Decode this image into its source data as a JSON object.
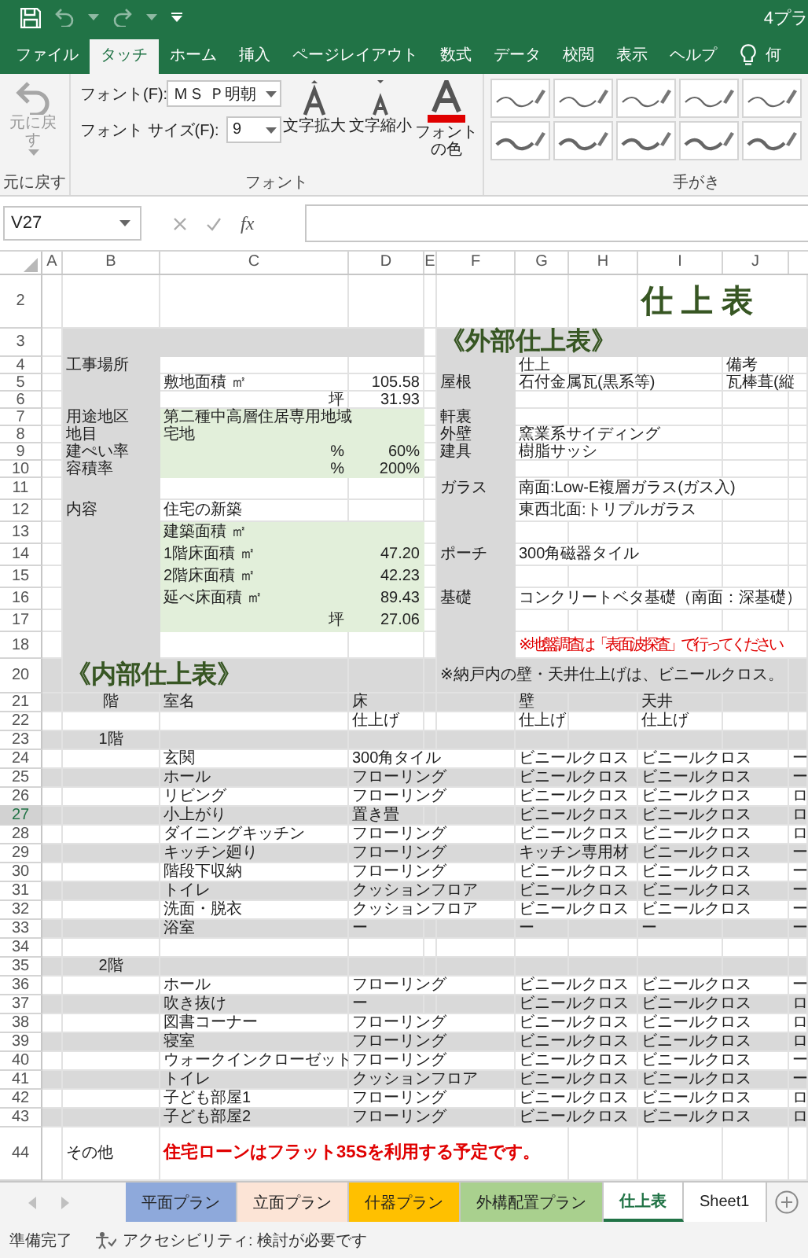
{
  "title_bar": {
    "title": "4プラ"
  },
  "ribbon_tabs": [
    {
      "label": "ファイル",
      "selected": false
    },
    {
      "label": "タッチ",
      "selected": true
    },
    {
      "label": "ホーム",
      "selected": false
    },
    {
      "label": "挿入",
      "selected": false
    },
    {
      "label": "ページレイアウト",
      "selected": false
    },
    {
      "label": "数式",
      "selected": false
    },
    {
      "label": "データ",
      "selected": false
    },
    {
      "label": "校閲",
      "selected": false
    },
    {
      "label": "表示",
      "selected": false
    },
    {
      "label": "ヘルプ",
      "selected": false
    }
  ],
  "tell_me": "何",
  "ribbon": {
    "undo": {
      "label": "元に戻す",
      "disabled": true
    },
    "font_label": "フォント(F):",
    "font_value": "ＭＳ Ｐ明朝",
    "size_label": "フォント サイズ(F):",
    "size_value": "9",
    "buttons": [
      {
        "kind": "grow",
        "label": "文字拡大"
      },
      {
        "kind": "shrink",
        "label": "文字縮小"
      },
      {
        "kind": "color",
        "label": "フォントの色"
      }
    ],
    "pens": [
      {
        "kind": "thin"
      },
      {
        "kind": "thin"
      },
      {
        "kind": "thin"
      },
      {
        "kind": "thin"
      },
      {
        "kind": "thin"
      },
      {
        "kind": "thick"
      },
      {
        "kind": "thick"
      },
      {
        "kind": "thick"
      },
      {
        "kind": "thick"
      },
      {
        "kind": "thick"
      }
    ],
    "groups": [
      "元に戻す",
      "フォント",
      "手がき"
    ]
  },
  "formula_bar": {
    "name_box": "V27",
    "function_label": "fx"
  },
  "columns": [
    "A",
    "B",
    "C",
    "D",
    "E",
    "F",
    "G",
    "H",
    "I",
    "J"
  ],
  "rows": [
    {
      "row": "2",
      "kind": "plain",
      "active": false,
      "cells": {
        "I": {
          "text": "仕 上 表",
          "kind": "title"
        }
      }
    },
    {
      "row": "3",
      "kind": "head",
      "active": false,
      "cells": {
        "F": {
          "text": "《外部仕上表》",
          "kind": "heading"
        }
      }
    },
    {
      "row": "4",
      "kind": "block",
      "active": false,
      "cells": {
        "B": {
          "text": "工事場所",
          "kind": "text"
        },
        "G": {
          "text": "仕上",
          "kind": "text"
        },
        "J": {
          "text": "備考",
          "kind": "text"
        }
      }
    },
    {
      "row": "5",
      "kind": "block",
      "active": false,
      "cells": {
        "C": {
          "text": "敷地面積 ㎡",
          "kind": "text"
        },
        "D": {
          "text": "105.58",
          "kind": "value"
        },
        "F": {
          "text": "屋根",
          "kind": "text"
        },
        "G": {
          "text": "石付金属瓦(黒系等)",
          "kind": "text"
        },
        "J": {
          "text": "瓦棒葺(縦",
          "kind": "text"
        }
      }
    },
    {
      "row": "6",
      "kind": "block",
      "active": false,
      "cells": {
        "C": {
          "text": "坪",
          "kind": "value"
        },
        "D": {
          "text": "31.93",
          "kind": "value"
        }
      }
    },
    {
      "row": "7",
      "kind": "entry",
      "active": false,
      "cells": {
        "B": {
          "text": "用途地区",
          "kind": "text"
        },
        "C": {
          "text": "第二種中高層住居専用地域",
          "kind": "text"
        },
        "F": {
          "text": "軒裏",
          "kind": "text"
        }
      }
    },
    {
      "row": "8",
      "kind": "entry",
      "active": false,
      "cells": {
        "B": {
          "text": "地目",
          "kind": "text"
        },
        "C": {
          "text": "宅地",
          "kind": "text"
        },
        "F": {
          "text": "外壁",
          "kind": "text"
        },
        "G": {
          "text": "窯業系サイディング",
          "kind": "text"
        }
      }
    },
    {
      "row": "9",
      "kind": "entry",
      "active": false,
      "cells": {
        "B": {
          "text": "建ぺい率",
          "kind": "text"
        },
        "C": {
          "text": "%",
          "kind": "value"
        },
        "D": {
          "text": "60%",
          "kind": "value"
        },
        "F": {
          "text": "建具",
          "kind": "text"
        },
        "G": {
          "text": "樹脂サッシ",
          "kind": "text"
        }
      }
    },
    {
      "row": "10",
      "kind": "entry",
      "active": false,
      "cells": {
        "B": {
          "text": "容積率",
          "kind": "text"
        },
        "C": {
          "text": "%",
          "kind": "value"
        },
        "D": {
          "text": "200%",
          "kind": "value"
        }
      }
    },
    {
      "row": "11",
      "kind": "block",
      "active": false,
      "cells": {
        "F": {
          "text": "ガラス",
          "kind": "text"
        },
        "G": {
          "text": "南面:Low-E複層ガラス(ガス入)",
          "kind": "text"
        }
      }
    },
    {
      "row": "12",
      "kind": "block",
      "active": false,
      "cells": {
        "B": {
          "text": "内容",
          "kind": "text"
        },
        "C": {
          "text": "住宅の新築",
          "kind": "text"
        },
        "G": {
          "text": "東西北面:トリプルガラス",
          "kind": "text"
        }
      }
    },
    {
      "row": "13",
      "kind": "entry",
      "active": false,
      "cells": {
        "C": {
          "text": "建築面積 ㎡",
          "kind": "text"
        }
      }
    },
    {
      "row": "14",
      "kind": "entry",
      "active": false,
      "cells": {
        "C": {
          "text": "1階床面積 ㎡",
          "kind": "text"
        },
        "D": {
          "text": "47.20",
          "kind": "value"
        },
        "F": {
          "text": "ポーチ",
          "kind": "text"
        },
        "G": {
          "text": "300角磁器タイル",
          "kind": "text"
        }
      }
    },
    {
      "row": "15",
      "kind": "entry",
      "active": false,
      "cells": {
        "C": {
          "text": "2階床面積 ㎡",
          "kind": "text"
        },
        "D": {
          "text": "42.23",
          "kind": "value"
        }
      }
    },
    {
      "row": "16",
      "kind": "entry",
      "active": false,
      "cells": {
        "C": {
          "text": "延べ床面積 ㎡",
          "kind": "text"
        },
        "D": {
          "text": "89.43",
          "kind": "value"
        },
        "F": {
          "text": "基礎",
          "kind": "text"
        },
        "G": {
          "text": "コンクリートベタ基礎（南面：深基礎）",
          "kind": "text"
        }
      }
    },
    {
      "row": "17",
      "kind": "entry",
      "active": false,
      "cells": {
        "C": {
          "text": "坪",
          "kind": "value"
        },
        "D": {
          "text": "27.06",
          "kind": "value"
        }
      }
    },
    {
      "row": "18",
      "kind": "block",
      "active": false,
      "cells": {
        "G": {
          "text": "※ 地盤調査は「表面波探査」で行ってください",
          "kind": "alert"
        }
      }
    },
    {
      "row": "20",
      "kind": "band",
      "active": false,
      "cells": {
        "B": {
          "text": "《内部仕上表》",
          "kind": "heading"
        },
        "F": {
          "text": "※納戸内の壁・天井仕上げは、ビニールクロス。",
          "kind": "text"
        }
      }
    },
    {
      "row": "21",
      "kind": "band",
      "active": false,
      "cells": {
        "B": {
          "text": "階",
          "kind": "floor"
        },
        "C": {
          "text": "室名",
          "kind": "text"
        },
        "D": {
          "text": "床",
          "kind": "text"
        },
        "G": {
          "text": "壁",
          "kind": "text"
        },
        "I": {
          "text": "天井",
          "kind": "text"
        }
      }
    },
    {
      "row": "22",
      "kind": "plain",
      "active": false,
      "cells": {
        "D": {
          "text": "仕上げ",
          "kind": "text"
        },
        "G": {
          "text": "仕上げ",
          "kind": "text"
        },
        "I": {
          "text": "仕上げ",
          "kind": "text"
        }
      }
    },
    {
      "row": "23",
      "kind": "band",
      "active": false,
      "cells": {
        "B": {
          "text": "1階",
          "kind": "floor"
        }
      }
    },
    {
      "row": "24",
      "kind": "plain",
      "active": false,
      "cells": {
        "C": {
          "text": "玄関",
          "kind": "text"
        },
        "D": {
          "text": "300角タイル",
          "kind": "text"
        },
        "G": {
          "text": "ビニールクロス",
          "kind": "text"
        },
        "I": {
          "text": "ビニールクロス",
          "kind": "text"
        },
        "K": {
          "text": "ー",
          "kind": "text"
        }
      }
    },
    {
      "row": "25",
      "kind": "band",
      "active": false,
      "cells": {
        "C": {
          "text": "ホール",
          "kind": "text"
        },
        "D": {
          "text": "フローリング",
          "kind": "text"
        },
        "G": {
          "text": "ビニールクロス",
          "kind": "text"
        },
        "I": {
          "text": "ビニールクロス",
          "kind": "text"
        },
        "K": {
          "text": "ー",
          "kind": "text"
        }
      }
    },
    {
      "row": "26",
      "kind": "plain",
      "active": false,
      "cells": {
        "C": {
          "text": "リビング",
          "kind": "text"
        },
        "D": {
          "text": "フローリング",
          "kind": "text"
        },
        "G": {
          "text": "ビニールクロス",
          "kind": "text"
        },
        "I": {
          "text": "ビニールクロス",
          "kind": "text"
        },
        "K": {
          "text": "ロ",
          "kind": "text"
        }
      }
    },
    {
      "row": "27",
      "kind": "band",
      "active": true,
      "cells": {
        "C": {
          "text": "小上がり",
          "kind": "text"
        },
        "D": {
          "text": "置き畳",
          "kind": "text"
        },
        "G": {
          "text": "ビニールクロス",
          "kind": "text"
        },
        "I": {
          "text": "ビニールクロス",
          "kind": "text"
        },
        "K": {
          "text": "ロ",
          "kind": "text"
        }
      }
    },
    {
      "row": "28",
      "kind": "plain",
      "active": false,
      "cells": {
        "C": {
          "text": "ダイニングキッチン",
          "kind": "text"
        },
        "D": {
          "text": "フローリング",
          "kind": "text"
        },
        "G": {
          "text": "ビニールクロス",
          "kind": "text"
        },
        "I": {
          "text": "ビニールクロス",
          "kind": "text"
        },
        "K": {
          "text": "ロ",
          "kind": "text"
        }
      }
    },
    {
      "row": "29",
      "kind": "band",
      "active": false,
      "cells": {
        "C": {
          "text": "キッチン廻り",
          "kind": "text"
        },
        "D": {
          "text": "フローリング",
          "kind": "text"
        },
        "G": {
          "text": "キッチン専用材",
          "kind": "text"
        },
        "I": {
          "text": "ビニールクロス",
          "kind": "text"
        },
        "K": {
          "text": "ー",
          "kind": "text"
        }
      }
    },
    {
      "row": "30",
      "kind": "plain",
      "active": false,
      "cells": {
        "C": {
          "text": "階段下収納",
          "kind": "text"
        },
        "D": {
          "text": "フローリング",
          "kind": "text"
        },
        "G": {
          "text": "ビニールクロス",
          "kind": "text"
        },
        "I": {
          "text": "ビニールクロス",
          "kind": "text"
        },
        "K": {
          "text": "ー",
          "kind": "text"
        }
      }
    },
    {
      "row": "31",
      "kind": "band",
      "active": false,
      "cells": {
        "C": {
          "text": "トイレ",
          "kind": "text"
        },
        "D": {
          "text": "クッションフロア",
          "kind": "text"
        },
        "G": {
          "text": "ビニールクロス",
          "kind": "text"
        },
        "I": {
          "text": "ビニールクロス",
          "kind": "text"
        },
        "K": {
          "text": "ー",
          "kind": "text"
        }
      }
    },
    {
      "row": "32",
      "kind": "plain",
      "active": false,
      "cells": {
        "C": {
          "text": "洗面・脱衣",
          "kind": "text"
        },
        "D": {
          "text": "クッションフロア",
          "kind": "text"
        },
        "G": {
          "text": "ビニールクロス",
          "kind": "text"
        },
        "I": {
          "text": "ビニールクロス",
          "kind": "text"
        },
        "K": {
          "text": "ー",
          "kind": "text"
        }
      }
    },
    {
      "row": "33",
      "kind": "band",
      "active": false,
      "cells": {
        "C": {
          "text": "浴室",
          "kind": "text"
        },
        "D": {
          "text": "ー",
          "kind": "text"
        },
        "G": {
          "text": "ー",
          "kind": "text"
        },
        "I": {
          "text": "ー",
          "kind": "text"
        },
        "K": {
          "text": "ー",
          "kind": "text"
        }
      }
    },
    {
      "row": "34",
      "kind": "plain",
      "active": false,
      "cells": {}
    },
    {
      "row": "35",
      "kind": "band",
      "active": false,
      "cells": {
        "B": {
          "text": "2階",
          "kind": "floor"
        }
      }
    },
    {
      "row": "36",
      "kind": "plain",
      "active": false,
      "cells": {
        "C": {
          "text": "ホール",
          "kind": "text"
        },
        "D": {
          "text": "フローリング",
          "kind": "text"
        },
        "G": {
          "text": "ビニールクロス",
          "kind": "text"
        },
        "I": {
          "text": "ビニールクロス",
          "kind": "text"
        },
        "K": {
          "text": "ー",
          "kind": "text"
        }
      }
    },
    {
      "row": "37",
      "kind": "band",
      "active": false,
      "cells": {
        "C": {
          "text": "吹き抜け",
          "kind": "text"
        },
        "D": {
          "text": "ー",
          "kind": "text"
        },
        "G": {
          "text": "ビニールクロス",
          "kind": "text"
        },
        "I": {
          "text": "ビニールクロス",
          "kind": "text"
        },
        "K": {
          "text": "ロ",
          "kind": "text"
        }
      }
    },
    {
      "row": "38",
      "kind": "plain",
      "active": false,
      "cells": {
        "C": {
          "text": "図書コーナー",
          "kind": "text"
        },
        "D": {
          "text": "フローリング",
          "kind": "text"
        },
        "G": {
          "text": "ビニールクロス",
          "kind": "text"
        },
        "I": {
          "text": "ビニールクロス",
          "kind": "text"
        },
        "K": {
          "text": "ロ",
          "kind": "text"
        }
      }
    },
    {
      "row": "39",
      "kind": "band",
      "active": false,
      "cells": {
        "C": {
          "text": "寝室",
          "kind": "text"
        },
        "D": {
          "text": "フローリング",
          "kind": "text"
        },
        "G": {
          "text": "ビニールクロス",
          "kind": "text"
        },
        "I": {
          "text": "ビニールクロス",
          "kind": "text"
        },
        "K": {
          "text": "ロ",
          "kind": "text"
        }
      }
    },
    {
      "row": "40",
      "kind": "plain",
      "active": false,
      "cells": {
        "C": {
          "text": "ウォークインクローゼット",
          "kind": "text"
        },
        "D": {
          "text": "フローリング",
          "kind": "text"
        },
        "G": {
          "text": "ビニールクロス",
          "kind": "text"
        },
        "I": {
          "text": "ビニールクロス",
          "kind": "text"
        },
        "K": {
          "text": "ー",
          "kind": "text"
        }
      }
    },
    {
      "row": "41",
      "kind": "band",
      "active": false,
      "cells": {
        "C": {
          "text": "トイレ",
          "kind": "text"
        },
        "D": {
          "text": "クッションフロア",
          "kind": "text"
        },
        "G": {
          "text": "ビニールクロス",
          "kind": "text"
        },
        "I": {
          "text": "ビニールクロス",
          "kind": "text"
        },
        "K": {
          "text": "ー",
          "kind": "text"
        }
      }
    },
    {
      "row": "42",
      "kind": "plain",
      "active": false,
      "cells": {
        "C": {
          "text": "子ども部屋1",
          "kind": "text"
        },
        "D": {
          "text": "フローリング",
          "kind": "text"
        },
        "G": {
          "text": "ビニールクロス",
          "kind": "text"
        },
        "I": {
          "text": "ビニールクロス",
          "kind": "text"
        },
        "K": {
          "text": "ロ",
          "kind": "text"
        }
      }
    },
    {
      "row": "43",
      "kind": "band",
      "active": false,
      "cells": {
        "C": {
          "text": "子ども部屋2",
          "kind": "text"
        },
        "D": {
          "text": "フローリング",
          "kind": "text"
        },
        "G": {
          "text": "ビニールクロス",
          "kind": "text"
        },
        "I": {
          "text": "ビニールクロス",
          "kind": "text"
        },
        "K": {
          "text": "ロ",
          "kind": "text"
        }
      }
    },
    {
      "row": "44",
      "kind": "plain",
      "active": false,
      "cells": {
        "B": {
          "text": "その他",
          "kind": "text"
        },
        "C": {
          "text": "住宅ローンはフラット35Sを利用する予定です。",
          "kind": "notice"
        }
      }
    }
  ],
  "sheet_tabs": [
    {
      "label": "平面プラン",
      "color": "#8ea9db",
      "selected": false
    },
    {
      "label": "立面プラン",
      "color": "#fce4d6",
      "selected": false
    },
    {
      "label": "什器プラン",
      "color": "#ffc000",
      "selected": false
    },
    {
      "label": "外構配置プラン",
      "color": "#a9d08e",
      "selected": false
    },
    {
      "label": "仕上表",
      "selected": true
    },
    {
      "label": "Sheet1",
      "selected": false
    }
  ],
  "status_bar": {
    "ready": "準備完了",
    "accessibility": "アクセシビリティ: 検討が必要です"
  }
}
